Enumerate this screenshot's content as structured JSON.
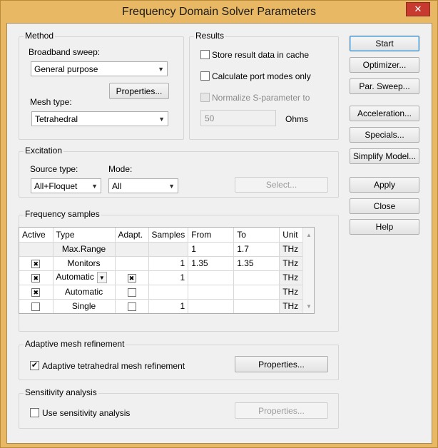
{
  "window": {
    "title": "Frequency Domain Solver Parameters",
    "close_glyph": "✕"
  },
  "method": {
    "title": "Method",
    "broadband_label": "Broadband sweep:",
    "broadband_value": "General purpose",
    "properties_label": "Properties...",
    "mesh_label": "Mesh type:",
    "mesh_value": "Tetrahedral"
  },
  "results": {
    "title": "Results",
    "store_cache": "Store result data in cache",
    "port_modes": "Calculate port modes only",
    "normalize": "Normalize S-parameter to",
    "ohms_value": "50",
    "ohms_unit": "Ohms"
  },
  "buttons": {
    "start": "Start",
    "optimizer": "Optimizer...",
    "par_sweep": "Par. Sweep...",
    "acceleration": "Acceleration...",
    "specials": "Specials...",
    "simplify": "Simplify Model...",
    "apply": "Apply",
    "close": "Close",
    "help": "Help"
  },
  "excitation": {
    "title": "Excitation",
    "source_label": "Source type:",
    "source_value": "All+Floquet",
    "mode_label": "Mode:",
    "mode_value": "All",
    "select_label": "Select..."
  },
  "freq": {
    "title": "Frequency samples",
    "headers": [
      "Active",
      "Type",
      "Adapt.",
      "Samples",
      "From",
      "To",
      "Unit"
    ],
    "rows": [
      {
        "type": "Max.Range",
        "samples": "",
        "from": "1",
        "to": "1.7",
        "unit": "THz"
      },
      {
        "type": "Monitors",
        "samples": "1",
        "from": "1.35",
        "to": "1.35",
        "unit": "THz"
      },
      {
        "type": "Automatic",
        "samples": "1",
        "from": "",
        "to": "",
        "unit": "THz"
      },
      {
        "type": "Automatic",
        "samples": "",
        "from": "",
        "to": "",
        "unit": "THz"
      },
      {
        "type": "Single",
        "samples": "1",
        "from": "",
        "to": "",
        "unit": "THz"
      }
    ]
  },
  "adaptive": {
    "title": "Adaptive mesh refinement",
    "checkbox": "Adaptive tetrahedral mesh refinement",
    "properties_label": "Properties..."
  },
  "sensitivity": {
    "title": "Sensitivity analysis",
    "checkbox": "Use sensitivity analysis",
    "properties_label": "Properties..."
  }
}
